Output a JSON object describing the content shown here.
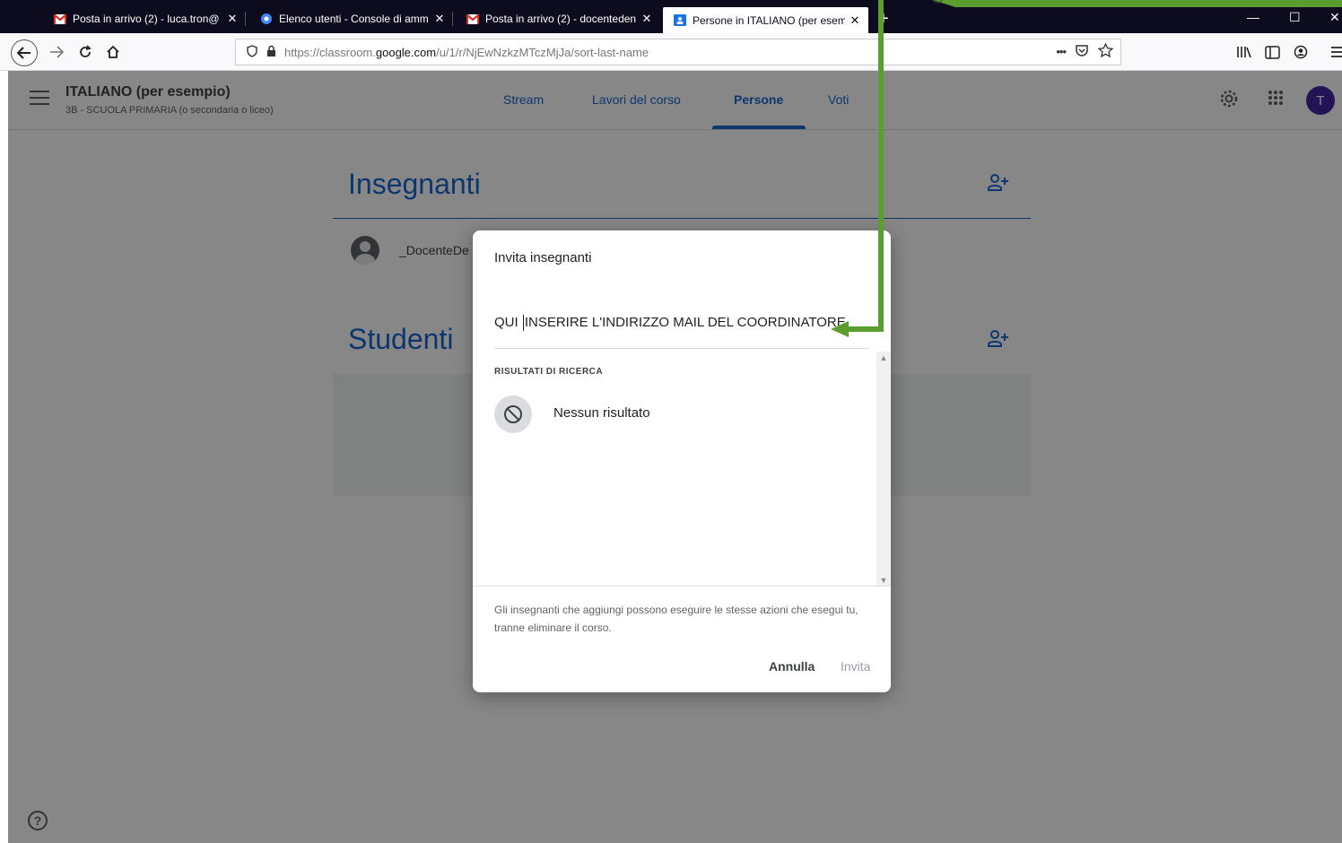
{
  "browser": {
    "tabs": [
      {
        "label": "Posta in arrivo (2) - luca.tron@",
        "icon": "gmail-icon",
        "active": false
      },
      {
        "label": "Elenco utenti - Console di amm",
        "icon": "admin-console-icon",
        "active": false
      },
      {
        "label": "Posta in arrivo (2) - docenteden",
        "icon": "gmail-icon",
        "active": false
      },
      {
        "label": "Persone in ITALIANO (per esem",
        "icon": "classroom-icon",
        "active": true
      }
    ],
    "close_glyph": "✕",
    "newtab_glyph": "+",
    "url_prefix": "https://classroom.",
    "url_domain": "google.com",
    "url_path": "/u/1/r/NjEwNzkzMTczMjJa/sort-last-name",
    "url_menu": "•••"
  },
  "course": {
    "title": "ITALIANO (per esempio)",
    "subtitle": "3B - SCUOLA PRIMARIA (o secondaria o liceo)",
    "avatar_letter": "T"
  },
  "nav_tabs": [
    {
      "label": "Stream"
    },
    {
      "label": "Lavori del corso"
    },
    {
      "label": "Persone"
    },
    {
      "label": "Voti"
    }
  ],
  "people": {
    "teachers_title": "Insegnanti",
    "teacher_name": "_DocenteDe",
    "students_title": "Studenti"
  },
  "dialog": {
    "title": "Invita insegnanti",
    "input_before_caret": "QUI ",
    "input_after_caret": "INSERIRE L'INDIRIZZO MAIL DEL COORDINATORE",
    "results_label": "RISULTATI DI RICERCA",
    "no_result": "Nessun risultato",
    "note": "Gli insegnanti che aggiungi possono eseguire le stesse azioni che esegui tu, tranne eliminare il corso.",
    "cancel_label": "Annulla",
    "invite_label": "Invita"
  },
  "help_glyph": "?",
  "colors": {
    "accent": "#1967d2",
    "annotation": "#5a9e2f",
    "tabbar": "#0c0c1e"
  }
}
